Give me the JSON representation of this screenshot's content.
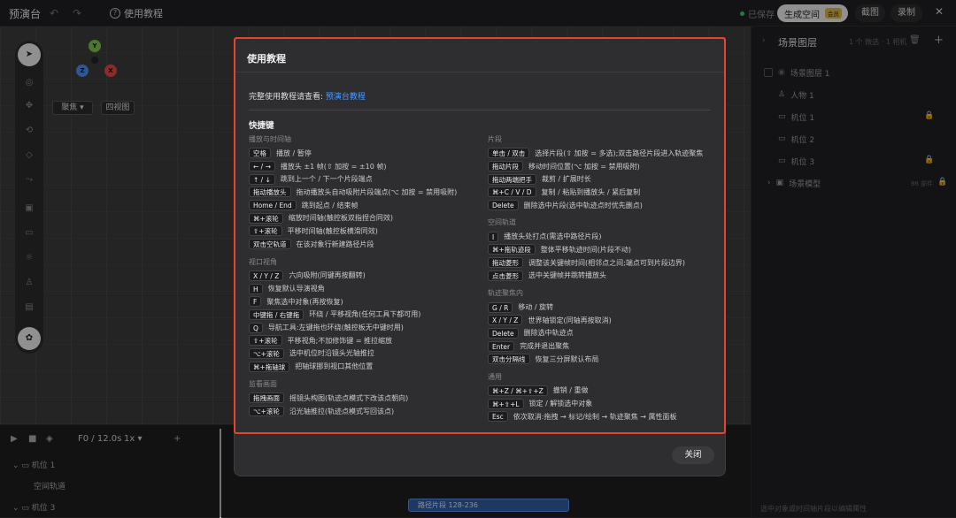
{
  "topbar": {
    "app_title": "预演台",
    "tutorial": "使用教程",
    "saved": "已保存",
    "generate": "生成空间",
    "vip": "会员",
    "screenshot": "截图",
    "record": "录制"
  },
  "viewport": {
    "gizmo": {
      "y": "Y",
      "z": "Z",
      "x": "X"
    },
    "focus": "聚焦",
    "four_view": "四视图"
  },
  "right_panel": {
    "title": "场景图层",
    "meta": "1 个 微选 · 1 相机",
    "items": [
      {
        "label": "场景图层 1",
        "icon": "eye-icon"
      },
      {
        "label": "人物 1",
        "icon": "person-icon"
      },
      {
        "label": "机位 1",
        "icon": "camera-icon",
        "locked": true
      },
      {
        "label": "机位 2",
        "icon": "camera-icon",
        "locked": false
      },
      {
        "label": "机位 3",
        "icon": "camera-icon",
        "locked": true
      },
      {
        "label": "场景模型",
        "icon": "cube-icon",
        "meta": "86 部件",
        "locked": true
      }
    ],
    "footer": "选中对象或时间轴片段以编辑属性"
  },
  "timeline": {
    "frame": "F0 / 12.0s",
    "speed": "1x",
    "rows": [
      "机位 1",
      "空间轨道",
      "机位 3"
    ],
    "clip": "路径片段 128-236"
  },
  "modal": {
    "title": "使用教程",
    "intro_text": "完整使用教程请查看:",
    "intro_link": "预演台教程",
    "shortcuts_title": "快捷键",
    "close": "关闭",
    "left_sections": [
      {
        "title": "播放与时间轴",
        "rows": [
          {
            "key": "空格",
            "desc": "播放 / 暂停"
          },
          {
            "key": "← / →",
            "desc": "播放头 ±1 帧(⇧ 加按 = ±10 帧)"
          },
          {
            "key": "↑ / ↓",
            "desc": "跳到上一个 / 下一个片段端点"
          },
          {
            "key": "拖动播放头",
            "desc": "拖动播放头自动吸附片段端点(⌥ 加按 = 禁用吸附)"
          },
          {
            "key": "Home / End",
            "desc": "跳到起点 / 结束帧"
          },
          {
            "key": "⌘+滚轮",
            "desc": "缩放时间轴(触控板双指捏合同效)"
          },
          {
            "key": "⇧+滚轮",
            "desc": "平移时间轴(触控板横滑同效)"
          },
          {
            "key": "双击空轨道",
            "desc": "在该对象行新建路径片段"
          }
        ]
      },
      {
        "title": "视口视角",
        "rows": [
          {
            "key": "X / Y / Z",
            "desc": "六向吸附(同键再按翻转)"
          },
          {
            "key": "H",
            "desc": "恢复默认导演视角"
          },
          {
            "key": "F",
            "desc": "聚焦选中对象(再按恢复)"
          },
          {
            "key": "中键拖 / 右键拖",
            "desc": "环绕 / 平移视角(任何工具下都可用)"
          },
          {
            "key": "Q",
            "desc": "导航工具:左键拖也环绕(触控板无中键时用)"
          },
          {
            "key": "⇧+滚轮",
            "desc": "平移视角;不加修饰键 = 推拉缩放"
          },
          {
            "key": "⌥+滚轮",
            "desc": "选中机位时沿镜头光轴推拉"
          },
          {
            "key": "⌘+拖轴球",
            "desc": "把轴球挪到视口其他位置"
          }
        ]
      },
      {
        "title": "监看画面",
        "rows": [
          {
            "key": "拖拽画面",
            "desc": "摇镜头构图(轨迹点模式下改该点朝向)"
          },
          {
            "key": "⌥+滚轮",
            "desc": "沿光轴推拉(轨迹点模式写回该点)"
          }
        ]
      }
    ],
    "right_sections": [
      {
        "title": "片段",
        "rows": [
          {
            "key": "单击 / 双击",
            "desc": "选择片段(⇧ 加按 = 多选);双击路径片段进入轨迹聚焦"
          },
          {
            "key": "拖动片段",
            "desc": "移动时间位置(⌥ 加按 = 禁用吸附)"
          },
          {
            "key": "拖动两端把手",
            "desc": "裁剪 / 扩展时长"
          },
          {
            "key": "⌘+C / V / D",
            "desc": "复制 / 粘贴到播放头 / 紧后复制"
          },
          {
            "key": "Delete",
            "desc": "删除选中片段(选中轨迹点时优先删点)"
          }
        ]
      },
      {
        "title": "空间轨道",
        "rows": [
          {
            "key": "I",
            "desc": "播放头处打点(需选中路径片段)"
          },
          {
            "key": "⌘+拖轨迹段",
            "desc": "整体平移轨迹时间(片段不动)"
          },
          {
            "key": "拖动菱形",
            "desc": "调整该关键帧时间(相邻点之间;端点可到片段边界)"
          },
          {
            "key": "点击菱形",
            "desc": "选中关键帧并跳转播放头"
          }
        ]
      },
      {
        "title": "轨迹聚焦内",
        "rows": [
          {
            "key": "G / R",
            "desc": "移动 / 旋转"
          },
          {
            "key": "X / Y / Z",
            "desc": "世界轴锁定(同轴再按取消)"
          },
          {
            "key": "Delete",
            "desc": "删除选中轨迹点"
          },
          {
            "key": "Enter",
            "desc": "完成并退出聚焦"
          },
          {
            "key": "双击分隔线",
            "desc": "恢复三分屏默认布局"
          }
        ]
      },
      {
        "title": "通用",
        "rows": [
          {
            "key": "⌘+Z / ⌘+⇧+Z",
            "desc": "撤销 / 重做"
          },
          {
            "key": "⌘+⇧+L",
            "desc": "锁定 / 解锁选中对象"
          },
          {
            "key": "Esc",
            "desc": "依次取消:拖拽 → 标记/绘制 → 轨迹聚焦 → 属性面板"
          }
        ]
      }
    ]
  }
}
